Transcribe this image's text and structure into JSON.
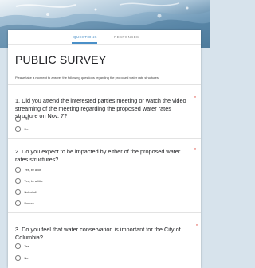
{
  "header": {
    "colors": {
      "water_dark": "#2f5c7d",
      "water_mid": "#7fa8c4",
      "water_light": "#dfeaf2"
    }
  },
  "tabs": [
    {
      "label": "QUESTIONS",
      "active": true
    },
    {
      "label": "RESPONSES",
      "active": false
    }
  ],
  "form": {
    "title": "PUBLIC SURVEY",
    "description": "Please take a moment to answer the following questions regarding the proposed water rate structures."
  },
  "questions": [
    {
      "text": "1. Did you attend the interested parties meeting or watch the video streaming of the meeting regarding the proposed water rates structure on Nov. 7?",
      "required_mark": "*",
      "options": [
        "Yes",
        "No"
      ]
    },
    {
      "text": "2. Do you expect to be impacted by either of the proposed water rates structures?",
      "required_mark": "*",
      "options": [
        "Yes, by a lot",
        "Yes, by a little",
        "Not at all",
        "Unsure"
      ]
    },
    {
      "text": "3. Do you feel that water conservation is important for the City of Columbia?",
      "required_mark": "*",
      "options": [
        "Yes",
        "No"
      ]
    }
  ],
  "colors": {
    "accent": "#4a90c8",
    "required": "#d93025"
  }
}
